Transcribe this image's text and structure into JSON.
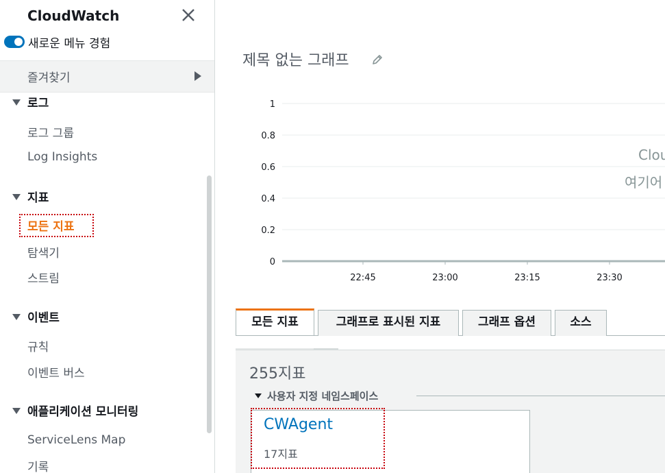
{
  "sidebar": {
    "title": "CloudWatch",
    "toggle_label": "새로운 메뉴 경험",
    "favorites_label": "즐겨찾기",
    "sections": [
      {
        "label": "로그",
        "items": [
          "로그 그룹",
          "Log Insights"
        ]
      },
      {
        "label": "지표",
        "items": [
          "모든 지표",
          "탐색기",
          "스트림"
        ]
      },
      {
        "label": "이벤트",
        "items": [
          "규칙",
          "이벤트 버스"
        ]
      },
      {
        "label": "애플리케이션 모니터링",
        "items": [
          "ServiceLens Map",
          "기록"
        ]
      }
    ],
    "active_item": "모든 지표"
  },
  "main": {
    "graph_title": "제목 없는 그래프",
    "overlay_line1": "Clou",
    "overlay_line2": "여기어",
    "tabs": [
      "모든 지표",
      "그래프로 표시된 지표",
      "그래프 옵션",
      "소스"
    ],
    "active_tab": "모든 지표",
    "metrics_count": "255지표",
    "namespace_heading": "사용자 지정 네임스페이스",
    "namespace_card": {
      "title": "CWAgent",
      "subtitle": "17지표"
    }
  },
  "chart_data": {
    "type": "line",
    "y_ticks": [
      "1",
      "0.8",
      "0.6",
      "0.4",
      "0.2",
      "0"
    ],
    "x_ticks": [
      "22:45",
      "23:00",
      "23:15",
      "23:30"
    ],
    "ylim": [
      0,
      1
    ],
    "grid": true,
    "series": []
  },
  "colors": {
    "accent": "#ec7211",
    "link": "#0073bb",
    "toggle": "#0073bb",
    "highlight_border": "#c7000b"
  }
}
